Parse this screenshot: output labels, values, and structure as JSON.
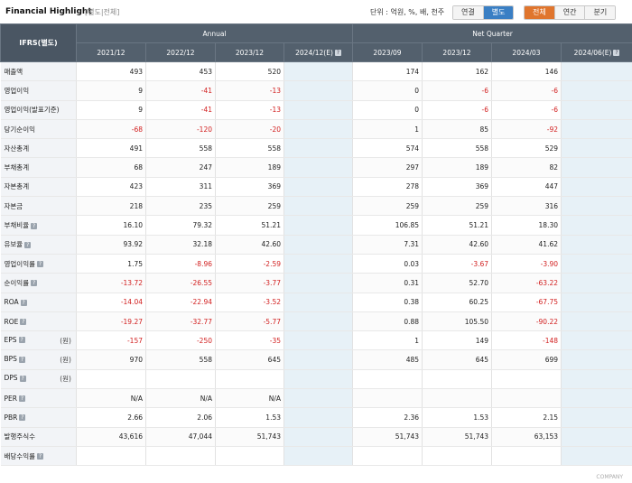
{
  "header": {
    "title": "Financial Highlight",
    "subtitle": "[별도|전체]",
    "unit_note": "단위 : 억원, %, 배, 천주",
    "toggle_consolidation": [
      "연결",
      "별도"
    ],
    "toggle_period": [
      "전체",
      "연간",
      "분기"
    ]
  },
  "table": {
    "corner_label": "IFRS(별도)",
    "group_annual": "Annual",
    "group_quarter": "Net Quarter",
    "columns": [
      "2021/12",
      "2022/12",
      "2023/12",
      "2024/12(E)",
      "2023/09",
      "2023/12",
      "2024/03",
      "2024/06(E)"
    ],
    "rows": [
      {
        "label": "매출액",
        "unit": "",
        "values": [
          "493",
          "453",
          "520",
          "",
          "174",
          "162",
          "146",
          ""
        ]
      },
      {
        "label": "영업이익",
        "unit": "",
        "values": [
          "9",
          "-41",
          "-13",
          "",
          "0",
          "-6",
          "-6",
          ""
        ]
      },
      {
        "label": "영업이익(발표기준)",
        "unit": "",
        "values": [
          "9",
          "-41",
          "-13",
          "",
          "0",
          "-6",
          "-6",
          ""
        ]
      },
      {
        "label": "당기순이익",
        "unit": "",
        "values": [
          "-68",
          "-120",
          "-20",
          "",
          "1",
          "85",
          "-92",
          ""
        ]
      },
      {
        "label": "자산총계",
        "unit": "",
        "values": [
          "491",
          "558",
          "558",
          "",
          "574",
          "558",
          "529",
          ""
        ]
      },
      {
        "label": "부채총계",
        "unit": "",
        "values": [
          "68",
          "247",
          "189",
          "",
          "297",
          "189",
          "82",
          ""
        ]
      },
      {
        "label": "자본총계",
        "unit": "",
        "values": [
          "423",
          "311",
          "369",
          "",
          "278",
          "369",
          "447",
          ""
        ]
      },
      {
        "label": "자본금",
        "unit": "",
        "values": [
          "218",
          "235",
          "259",
          "",
          "259",
          "259",
          "316",
          ""
        ]
      },
      {
        "label": "부채비율",
        "unit": "",
        "values": [
          "16.10",
          "79.32",
          "51.21",
          "",
          "106.85",
          "51.21",
          "18.30",
          ""
        ]
      },
      {
        "label": "유보율",
        "unit": "",
        "values": [
          "93.92",
          "32.18",
          "42.60",
          "",
          "7.31",
          "42.60",
          "41.62",
          ""
        ]
      },
      {
        "label": "영업이익률",
        "unit": "",
        "values": [
          "1.75",
          "-8.96",
          "-2.59",
          "",
          "0.03",
          "-3.67",
          "-3.90",
          ""
        ]
      },
      {
        "label": "순이익률",
        "unit": "",
        "values": [
          "-13.72",
          "-26.55",
          "-3.77",
          "",
          "0.31",
          "52.70",
          "-63.22",
          ""
        ]
      },
      {
        "label": "ROA",
        "unit": "",
        "values": [
          "-14.04",
          "-22.94",
          "-3.52",
          "",
          "0.38",
          "60.25",
          "-67.75",
          ""
        ]
      },
      {
        "label": "ROE",
        "unit": "",
        "values": [
          "-19.27",
          "-32.77",
          "-5.77",
          "",
          "0.88",
          "105.50",
          "-90.22",
          ""
        ]
      },
      {
        "label": "EPS",
        "unit": "(원)",
        "values": [
          "-157",
          "-250",
          "-35",
          "",
          "1",
          "149",
          "-148",
          ""
        ]
      },
      {
        "label": "BPS",
        "unit": "(원)",
        "values": [
          "970",
          "558",
          "645",
          "",
          "485",
          "645",
          "699",
          ""
        ]
      },
      {
        "label": "DPS",
        "unit": "(원)",
        "values": [
          "",
          "",
          "",
          "",
          "",
          "",
          "",
          ""
        ]
      },
      {
        "label": "PER",
        "unit": "",
        "values": [
          "N/A",
          "N/A",
          "N/A",
          "",
          "",
          "",
          "",
          ""
        ]
      },
      {
        "label": "PBR",
        "unit": "",
        "values": [
          "2.66",
          "2.06",
          "1.53",
          "",
          "2.36",
          "1.53",
          "2.15",
          ""
        ]
      },
      {
        "label": "발행주식수",
        "unit": "",
        "values": [
          "43,616",
          "47,044",
          "51,743",
          "",
          "51,743",
          "51,743",
          "63,153",
          ""
        ]
      },
      {
        "label": "배당수익률",
        "unit": "",
        "values": [
          "",
          "",
          "",
          "",
          "",
          "",
          "",
          ""
        ]
      }
    ]
  },
  "help_rows": [
    "부채비율",
    "유보율",
    "영업이익률",
    "순이익률",
    "ROA",
    "ROE",
    "EPS",
    "BPS",
    "DPS",
    "PER",
    "PBR",
    "배당수익률"
  ],
  "colors": {
    "header_bg": "#53606d",
    "negative": "#d22020",
    "estimate_bg": "#e7f1f7",
    "accent_orange": "#e0752d",
    "accent_blue": "#3a7fc4"
  },
  "footer": "COMPANY"
}
